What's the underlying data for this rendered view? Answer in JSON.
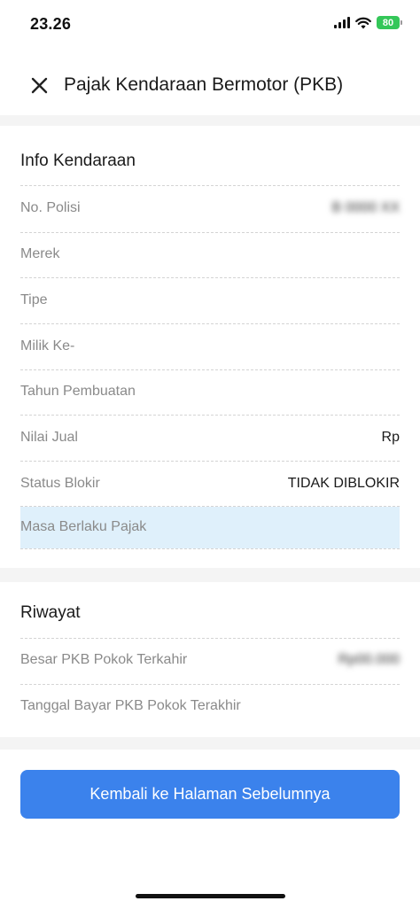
{
  "status_bar": {
    "time": "23.26",
    "battery": "80"
  },
  "header": {
    "title": "Pajak Kendaraan Bermotor (PKB)"
  },
  "info": {
    "title": "Info Kendaraan",
    "rows": [
      {
        "label": "No. Polisi",
        "value": "B 0000 XX"
      },
      {
        "label": "Merek",
        "value": ""
      },
      {
        "label": "Tipe",
        "value": ""
      },
      {
        "label": "Milik Ke-",
        "value": ""
      },
      {
        "label": "Tahun Pembuatan",
        "value": ""
      },
      {
        "label": "Nilai Jual",
        "value": "Rp"
      },
      {
        "label": "Status Blokir",
        "value": "TIDAK DIBLOKIR"
      },
      {
        "label": "Masa Berlaku Pajak",
        "value": ""
      }
    ]
  },
  "history": {
    "title": "Riwayat",
    "rows": [
      {
        "label": "Besar PKB Pokok Terkahir",
        "value": "Rp00.000"
      },
      {
        "label": "Tanggal Bayar PKB Pokok Terakhir",
        "value": ""
      }
    ]
  },
  "actions": {
    "back_label": "Kembali ke Halaman Sebelumnya"
  },
  "colors": {
    "primary": "#3b82ec",
    "highlight": "#dff0fb",
    "battery": "#34c759"
  },
  "icons": {
    "close": "close-icon",
    "signal": "signal-icon",
    "wifi": "wifi-icon",
    "battery": "battery-icon"
  }
}
